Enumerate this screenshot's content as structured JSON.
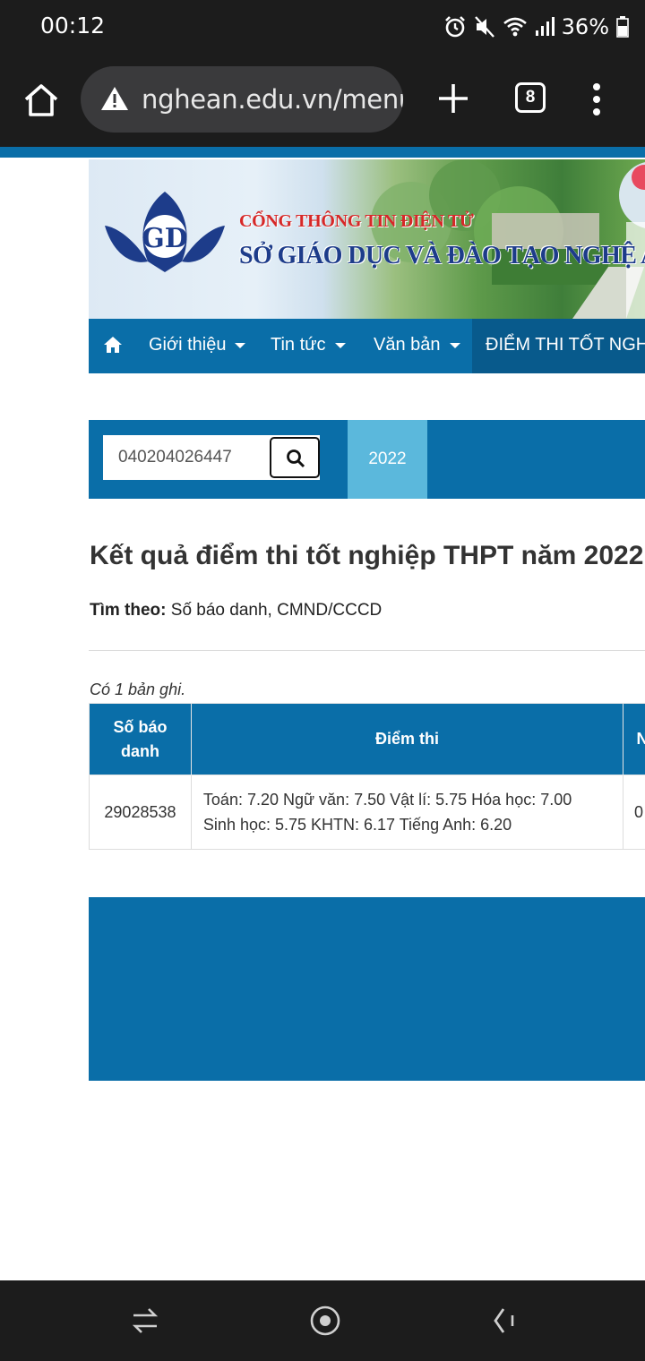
{
  "status_bar": {
    "time": "00:12",
    "battery": "36%",
    "icons": [
      "alarm-icon",
      "mute-icon",
      "wifi-icon",
      "signal-icon",
      "battery-icon"
    ]
  },
  "browser": {
    "url": "nghean.edu.vn/menu",
    "tab_count": "8",
    "icons": [
      "home-icon",
      "not-secure-warning-icon",
      "plus-icon",
      "tabs-icon",
      "more-vert-icon"
    ]
  },
  "banner": {
    "line1": "CỔNG THÔNG TIN ĐIỆN TỬ",
    "line2": "SỞ GIÁO DỤC VÀ ĐÀO TẠO NGHỆ AN"
  },
  "nav": {
    "items": [
      {
        "label": "Giới thiệu"
      },
      {
        "label": "Tin tức"
      },
      {
        "label": "Văn bản"
      }
    ],
    "active": "ĐIỂM THI TỐT NGHIỆP"
  },
  "search": {
    "value": "040204026447",
    "year": "2022"
  },
  "result": {
    "title": "Kết quả điểm thi tốt nghiệp THPT năm 2022",
    "search_by_label": "Tìm theo:",
    "search_by_value": "Số báo danh, CMND/CCCD",
    "record_count": "Có 1 bản ghi.",
    "columns": [
      "Số báo\ndanh",
      "Điểm thi",
      "N"
    ],
    "rows": [
      {
        "sbd": "29028538",
        "scores_line1": "Toán: 7.20 Ngữ văn: 7.50 Vật lí: 5.75 Hóa học: 7.00",
        "scores_line2": "Sinh học: 5.75 KHTN: 6.17 Tiếng Anh: 6.20",
        "extra": "0"
      }
    ]
  },
  "colors": {
    "primary_blue": "#0a6ea8",
    "active_tab": "#5bb8dc",
    "title_red": "#d62828",
    "title_navy": "#1d3c8a"
  }
}
